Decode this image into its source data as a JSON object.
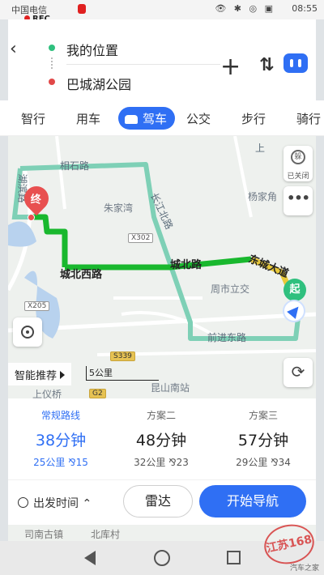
{
  "status_bar": {
    "carrier": "中国电信",
    "rec": "REC",
    "icons": "👁 ✱ ◎ ▣",
    "time": "08:55"
  },
  "search": {
    "from": "我的位置",
    "to": "巴城湖公园"
  },
  "tabs": [
    {
      "label": "智行"
    },
    {
      "label": "用车"
    },
    {
      "label": "驾车",
      "active": true
    },
    {
      "label": "公交"
    },
    {
      "label": "步行"
    },
    {
      "label": "骑行"
    }
  ],
  "map": {
    "places": [
      "朱家湾",
      "杨家角",
      "周市立交",
      "昆山南站"
    ],
    "roads": [
      "相石路",
      "长江北路",
      "前进东路",
      "湖滨路",
      "上"
    ],
    "route_roads": [
      "城北西路",
      "城北路",
      "东城大道"
    ],
    "shields": [
      "X302",
      "X205",
      "S339",
      "G2"
    ],
    "end_marker": "终",
    "start_marker": "起",
    "traffic_label": "已关闭",
    "traffic_ring": "躲",
    "more": "•••",
    "refresh": "⟳",
    "smart_recommend": "智能推荐",
    "scale": "5公里",
    "bottom_labels": [
      "上仪桥",
      "北库村",
      "司南古镇"
    ]
  },
  "routes": [
    {
      "name": "常规路线",
      "duration": "38分钟",
      "meta": "25公里  ⅋15",
      "active": true
    },
    {
      "name": "方案二",
      "duration": "48分钟",
      "meta": "32公里  ⅋23"
    },
    {
      "name": "方案三",
      "duration": "57分钟",
      "meta": "29公里  ⅋34"
    }
  ],
  "actions": {
    "depart_time": "出发时间 ⌃",
    "radar": "雷达",
    "start_nav": "开始导航"
  },
  "stamp": "江苏168",
  "watermark": "汽车之家",
  "colors": {
    "accent": "#2f6ff4",
    "route_green": "#19b82e",
    "route_yellow": "#e8c93a",
    "end_red": "#e85050",
    "start_green": "#2fc07e"
  }
}
